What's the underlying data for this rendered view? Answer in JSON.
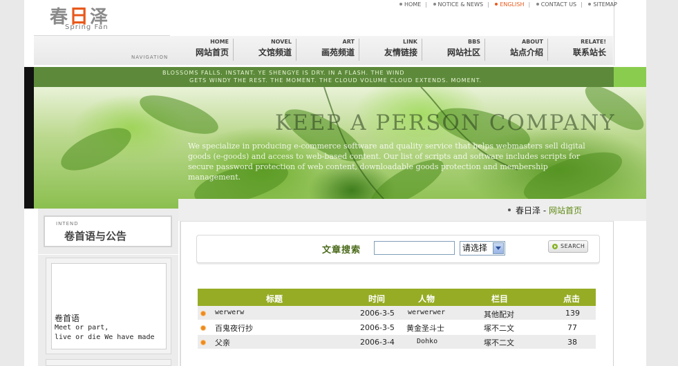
{
  "logo": {
    "cn_pre": "春",
    "cn_mark": "日",
    "cn_post": "泽",
    "en": "Spring Fan"
  },
  "top_links": [
    {
      "label": "HOME"
    },
    {
      "label": "NOTICE & NEWS"
    },
    {
      "label": "ENGLISH"
    },
    {
      "label": "CONTACT US"
    },
    {
      "label": "SITEMAP"
    }
  ],
  "nav": {
    "label": "NAVIGATION",
    "items": [
      {
        "en": "HOME",
        "cn": "网站首页"
      },
      {
        "en": "NOVEL",
        "cn": "文馆频道"
      },
      {
        "en": "ART",
        "cn": "画苑频道"
      },
      {
        "en": "LINK",
        "cn": "友情链接"
      },
      {
        "en": "BBS",
        "cn": "网站社区"
      },
      {
        "en": "ABOUT",
        "cn": "站点介绍"
      },
      {
        "en": "RELATE!",
        "cn": "联系站长"
      }
    ]
  },
  "banner": {
    "line1": "BLOSSOMS FALLS. INSTANT. YE SHENGYE IS DRY. IN A FLASH. THE WIND",
    "line2": "GETS WINDY THE REST. THE MOMENT. THE CLOUD VOLUME CLOUD EXTENDS. MOMENT.",
    "title": "KEEP A PERSON COMPANY",
    "desc": "We specialize in producing e-commerce software and quality service that helps webmasters sell digital goods (e-goods) and access to web-based content. Our list of scripts and software includes scripts for secure password protection of web content, downloadable goods protection and membership management."
  },
  "sidebar": {
    "head_en": "INTEND",
    "head_cn": "卷首语与公告",
    "intro_title": "卷首语",
    "intro_line1": "Meet or part,",
    "intro_line2": "live or die We have made"
  },
  "breadcrumb": {
    "site": "春日泽",
    "sep": "-",
    "current": "网站首页"
  },
  "search": {
    "label": "文章搜索",
    "input_value": "",
    "select_value": "请选择",
    "button_label": "SEARCH"
  },
  "table": {
    "headers": [
      "标题",
      "时间",
      "人物",
      "栏目",
      "点击"
    ],
    "rows": [
      {
        "title": "werwerw",
        "date": "2006-3-5",
        "person": "werwerwer",
        "column": "其他配对",
        "clicks": "139"
      },
      {
        "title": "百鬼夜行抄",
        "date": "2006-3-5",
        "person": "黄金圣斗士",
        "column": "塚不二文",
        "clicks": "77"
      },
      {
        "title": "父亲",
        "date": "2006-3-4",
        "person": "Dohko",
        "column": "塚不二文",
        "clicks": "38"
      }
    ]
  },
  "colors": {
    "accent_green": "#96ac25",
    "accent_orange": "#e8581a"
  }
}
